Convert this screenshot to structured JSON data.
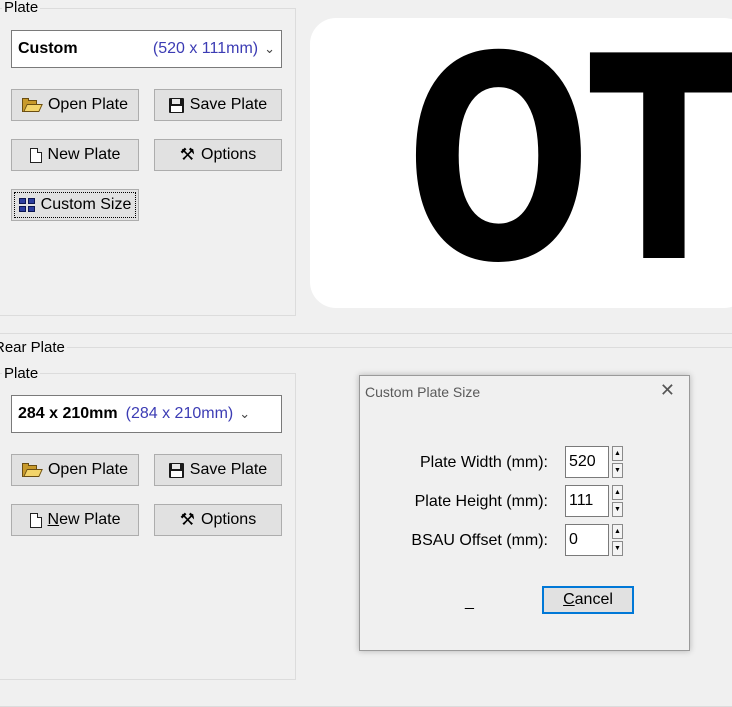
{
  "front": {
    "plate_group_label": "Plate",
    "combo": {
      "name": "Custom",
      "dims": "(520 x 111mm)"
    },
    "buttons": {
      "open": "Open Plate",
      "save": "Save Plate",
      "new": "New Plate",
      "options": "Options",
      "custom_size": "Custom Size"
    },
    "preview_text": "OT"
  },
  "rear": {
    "group_label": "Rear Plate",
    "plate_group_label": "Plate",
    "combo": {
      "name": "284 x 210mm",
      "dims": "(284 x 210mm)"
    },
    "buttons": {
      "open": "Open Plate",
      "save": "Save Plate",
      "new_prefix": "N",
      "new_rest": "ew Plate",
      "options": "Options"
    }
  },
  "dialog": {
    "title": "Custom Plate Size",
    "fields": {
      "width_label": "Plate Width (mm):",
      "width_value": "520",
      "height_label": "Plate Height (mm):",
      "height_value": "111",
      "offset_label": "BSAU Offset (mm):",
      "offset_value": "0"
    },
    "underscore": "_",
    "cancel_prefix": "C",
    "cancel_rest": "ancel"
  },
  "icons": {
    "close": "close-icon",
    "open": "folder-icon",
    "save": "floppy-icon",
    "new": "document-icon",
    "options": "tools-icon",
    "custom_size": "grid-icon"
  }
}
